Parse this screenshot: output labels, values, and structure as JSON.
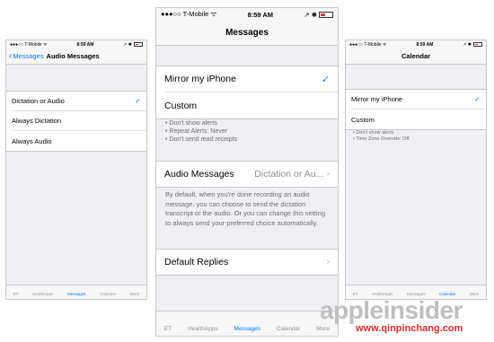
{
  "left": {
    "status": {
      "carrier": "●●●○○ T-Mobile ᯤ",
      "time": "8:59 AM",
      "right": "↗ ✱"
    },
    "nav": {
      "back_label": "Messages",
      "title": "Audio Messages"
    },
    "options": [
      {
        "label": "Dictation or Audio",
        "checked": true,
        "check": "✓"
      },
      {
        "label": "Always Dictation"
      },
      {
        "label": "Always Audio"
      }
    ],
    "tabs": [
      "ET",
      "HealthApps",
      "Messages",
      "Calendar",
      "More"
    ],
    "more_dots": "○○○"
  },
  "center": {
    "status": {
      "carrier": "●●●○○ T-Mobile ᯤ",
      "time": "8:59 AM",
      "right": "↗ ✱"
    },
    "nav": {
      "title": "Messages"
    },
    "options": [
      {
        "label": "Mirror my iPhone",
        "checked": true,
        "check": "✓"
      },
      {
        "label": "Custom"
      }
    ],
    "custom_notes": [
      "• Don't show alerts",
      "• Repeat Alerts: Never",
      "• Don't send read receipts"
    ],
    "audio_messages": {
      "label": "Audio Messages",
      "value": "Dictation or Au...",
      "chevron": "›"
    },
    "audio_description": "By default, when you're done recording an audio message, you can choose to send the dictation transcript or the audio. Or you can change this setting to always send your preferred choice automatically.",
    "default_replies": {
      "label": "Default Replies",
      "chevron": "›"
    },
    "tabs": [
      "ET",
      "HealthApps",
      "Messages",
      "Calendar",
      "More"
    ],
    "more_dots": "○○○"
  },
  "right": {
    "status": {
      "carrier": "●●●○○ T-Mobile ᯤ",
      "time": "8:59 AM",
      "right": "↗ ✱"
    },
    "nav": {
      "title": "Calendar"
    },
    "options": [
      {
        "label": "Mirror my iPhone",
        "checked": true,
        "check": "✓"
      },
      {
        "label": "Custom"
      }
    ],
    "custom_notes": [
      "• Don't show alerts",
      "• Time Zone Override: Off"
    ],
    "tabs": [
      "ET",
      "HealthApps",
      "Messages",
      "Calendar",
      "More"
    ],
    "more_dots": "○○○"
  },
  "watermark": {
    "logo": "appleinsider",
    "url": "www.qinpinchang.com"
  },
  "colors": {
    "accent": "#007aff",
    "background": "#efeff4",
    "bar": "#f7f7f7",
    "watermark_red": "#d92a2a"
  }
}
